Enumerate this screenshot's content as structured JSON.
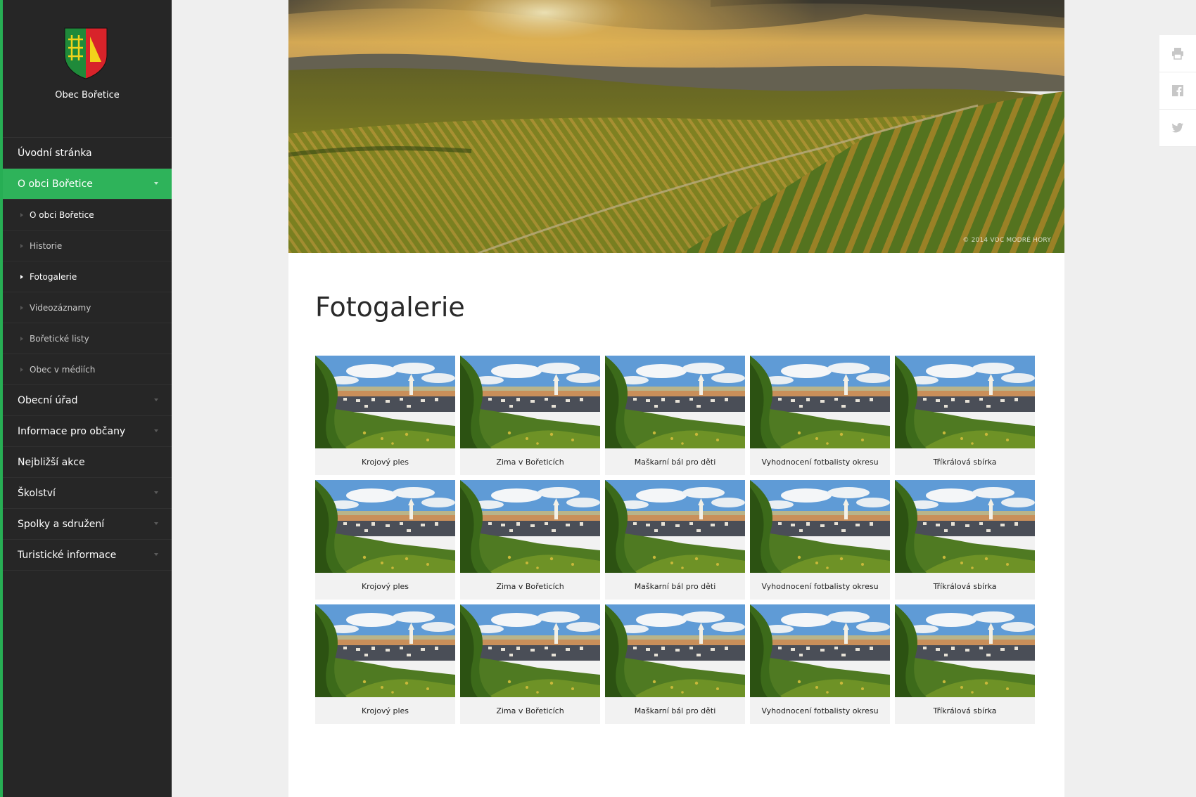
{
  "site": {
    "name": "Obec Bořetice",
    "colors": {
      "accent": "#2eb35a",
      "sidebar": "#262626"
    }
  },
  "nav": [
    {
      "label": "Úvodní stránka",
      "has_children": false
    },
    {
      "label": "O obci Bořetice",
      "has_children": true,
      "active": true
    },
    {
      "label": "Obecní úřad",
      "has_children": true
    },
    {
      "label": "Informace pro občany",
      "has_children": true
    },
    {
      "label": "Nejbližší akce",
      "has_children": false
    },
    {
      "label": "Školství",
      "has_children": true
    },
    {
      "label": "Spolky a sdružení",
      "has_children": true
    },
    {
      "label": "Turistické informace",
      "has_children": true
    }
  ],
  "subnav": [
    {
      "label": "O obci Bořetice"
    },
    {
      "label": "Historie"
    },
    {
      "label": "Fotogalerie",
      "current": true
    },
    {
      "label": "Videozáznamy"
    },
    {
      "label": "Bořetické listy"
    },
    {
      "label": "Obec v médiích"
    }
  ],
  "hero": {
    "credit": "© 2014 VOC MODRÉ HORY"
  },
  "page": {
    "title": "Fotogalerie"
  },
  "gallery": [
    {
      "caption": "Krojový ples"
    },
    {
      "caption": "Zima v Bořeticích"
    },
    {
      "caption": "Maškarní bál pro děti"
    },
    {
      "caption": "Vyhodnocení fotbalisty okresu"
    },
    {
      "caption": "Tříkrálová sbírka"
    },
    {
      "caption": "Krojový ples"
    },
    {
      "caption": "Zima v Bořeticích"
    },
    {
      "caption": "Maškarní bál pro děti"
    },
    {
      "caption": "Vyhodnocení fotbalisty okresu"
    },
    {
      "caption": "Tříkrálová sbírka"
    },
    {
      "caption": "Krojový ples"
    },
    {
      "caption": "Zima v Bořeticích"
    },
    {
      "caption": "Maškarní bál pro děti"
    },
    {
      "caption": "Vyhodnocení fotbalisty okresu"
    },
    {
      "caption": "Tříkrálová sbírka"
    }
  ],
  "share": [
    {
      "icon": "print-icon"
    },
    {
      "icon": "facebook-icon"
    },
    {
      "icon": "twitter-icon"
    }
  ]
}
